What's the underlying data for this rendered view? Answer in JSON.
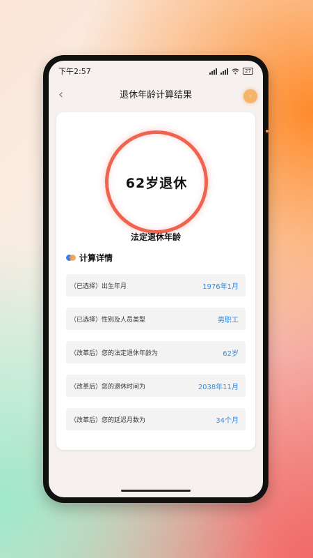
{
  "statusbar": {
    "time": "下午2:57",
    "battery": "27"
  },
  "nav": {
    "title": "退休年龄计算结果"
  },
  "result": {
    "ring_text": "62岁退休",
    "label": "法定退休年龄"
  },
  "details": {
    "title": "计算详情",
    "rows": [
      {
        "label": "（已选择）出生年月",
        "value": "1976年1月"
      },
      {
        "label": "（已选择）性别及人员类型",
        "value": "男职工"
      },
      {
        "label": "（改革后）您的法定退休年龄为",
        "value": "62岁"
      },
      {
        "label": "（改革后）您的退休时间为",
        "value": "2038年11月"
      },
      {
        "label": "（改革后）您的延迟月数为",
        "value": "34个月"
      }
    ]
  },
  "colors": {
    "accent_ring": "#ef6450",
    "value_text": "#2f8be6"
  },
  "icons": [
    "back-chevron-icon",
    "signal-icon",
    "wifi-icon",
    "battery-icon",
    "dots-icon"
  ]
}
